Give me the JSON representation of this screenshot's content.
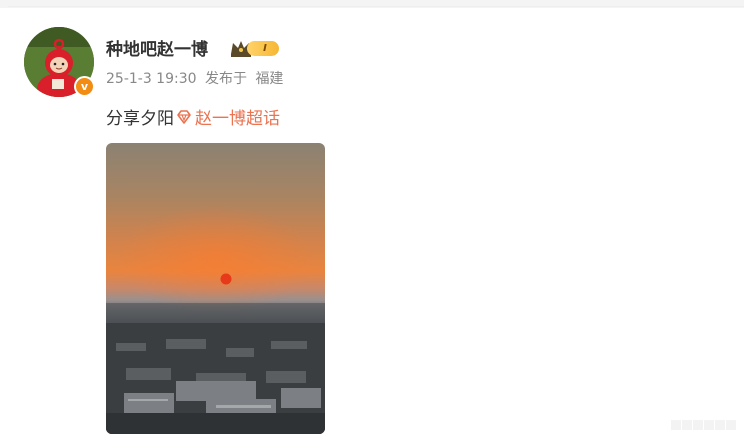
{
  "post": {
    "username": "种地吧赵一博",
    "level": "I",
    "verified_mark": "v",
    "timestamp": "25-1-3 19:30",
    "published_label": "发布于",
    "location": "福建",
    "text": "分享夕阳",
    "supertopic": "赵一博超话",
    "image_icon": "sunset-photo"
  },
  "icons": {
    "crown": "crown-icon",
    "supertopic": "diamond-icon",
    "avatar": "teletubby-avatar"
  },
  "colors": {
    "link": "#eb7350",
    "verified": "#f28c12",
    "text": "#333333",
    "meta": "#888888"
  }
}
